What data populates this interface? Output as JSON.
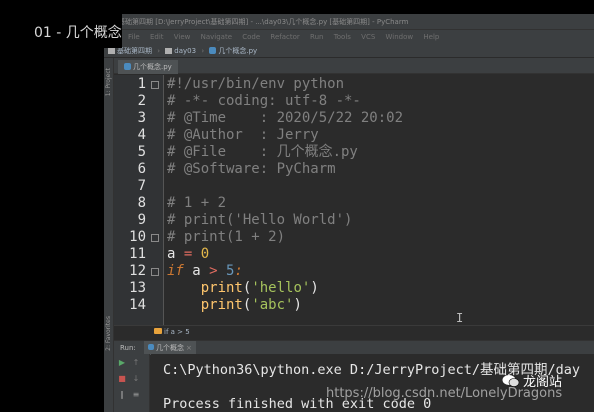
{
  "video": {
    "title": "01 - 几个概念"
  },
  "window": {
    "title": "基础第四期 [D:\\JerryProject\\基础第四期] - ...\\day03\\几个概念.py [基础第四期] - PyCharm"
  },
  "menu": [
    "File",
    "Edit",
    "View",
    "Navigate",
    "Code",
    "Refactor",
    "Run",
    "Tools",
    "VCS",
    "Window",
    "Help"
  ],
  "navbar": {
    "project": "基础第四期",
    "folder": "day03",
    "file": "几个概念.py"
  },
  "sidebar": {
    "project_label": "1: Project",
    "favorites_label": "2: Favorites"
  },
  "editor": {
    "tab_label": "几个概念.py",
    "line_numbers": [
      "1",
      "2",
      "3",
      "4",
      "5",
      "6",
      "7",
      "8",
      "9",
      "10",
      "11",
      "12",
      "13",
      "14"
    ],
    "lines": {
      "l1": "#!/usr/bin/env python",
      "l2": "# -*- coding: utf-8 -*-",
      "l3": "# @Time    : 2020/5/22 20:02",
      "l4": "# @Author  : Jerry",
      "l5": "# @File    : 几个概念.py",
      "l6": "# @Software: PyCharm",
      "l8": "# 1 + 2",
      "l9": "# print('Hello World')",
      "l10": "# print(1 + 2)",
      "l11": {
        "var": "a",
        "op": "=",
        "num": "0"
      },
      "l12": {
        "kw": "if",
        "var": "a",
        "op": ">",
        "num": "5",
        "colon": ":"
      },
      "l13": {
        "indent": "    ",
        "fn": "print",
        "open": "(",
        "str": "'hello'",
        "close": ")"
      },
      "l14": {
        "indent": "    ",
        "fn": "print",
        "open": "(",
        "str": "'abc'",
        "close": ")"
      }
    },
    "breadcrumb": "if a > 5"
  },
  "run": {
    "label": "Run:",
    "tab": "几个概念",
    "console": [
      "C:\\Python36\\python.exe D:/JerryProject/基础第四期/day",
      "",
      "Process finished with exit code 0"
    ]
  },
  "overlay": {
    "watermark": "https://blog.csdn.net/LonelyDragons",
    "brand": "龙阁站"
  },
  "colors": {
    "editor_bg": "#2b2b2b",
    "comment": "#808080",
    "keyword": "#cc7832",
    "string": "#a5c25c",
    "number": "#6897bb"
  }
}
